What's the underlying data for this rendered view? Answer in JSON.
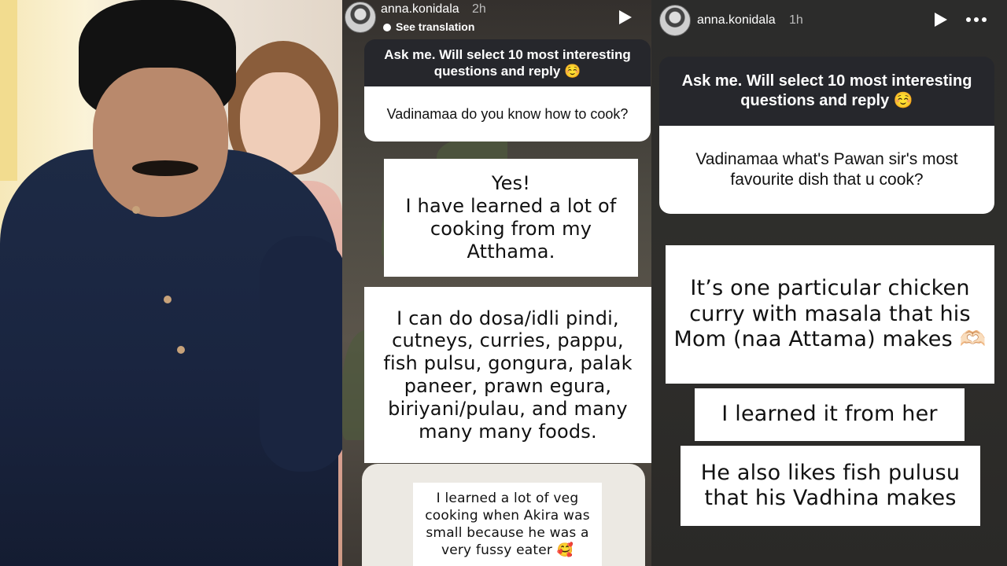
{
  "photo": {
    "alt": "photo-of-couple"
  },
  "story_left": {
    "username": "anna.konidala",
    "time": "2h",
    "see_translation": "See translation",
    "question_prompt": "Ask me. Will select 10 most interesting questions and reply ☺️",
    "question": "Vadinamaa do you know how to cook?",
    "replies": [
      "Yes!\nI have learned a lot of cooking from my Atthama.",
      "I can do dosa/idli pindi, cutneys, curries, pappu, fish pulsu, gongura, palak paneer, prawn egura, biriyani/pulau,  and many many many foods.",
      "I learned a lot of veg cooking when Akira was small because he was a very fussy eater 🥰"
    ]
  },
  "story_right": {
    "username": "anna.konidala",
    "time": "1h",
    "question_prompt": "Ask me. Will select 10 most interesting questions and reply ☺️",
    "question": "Vadinamaa what's Pawan sir's most favourite dish that u cook?",
    "replies": [
      "It’s one particular chicken curry with masala that his Mom (naa Attama) makes 🫶🏻",
      "I learned it from her",
      "He also likes fish pulusu that his Vadhina makes"
    ]
  }
}
